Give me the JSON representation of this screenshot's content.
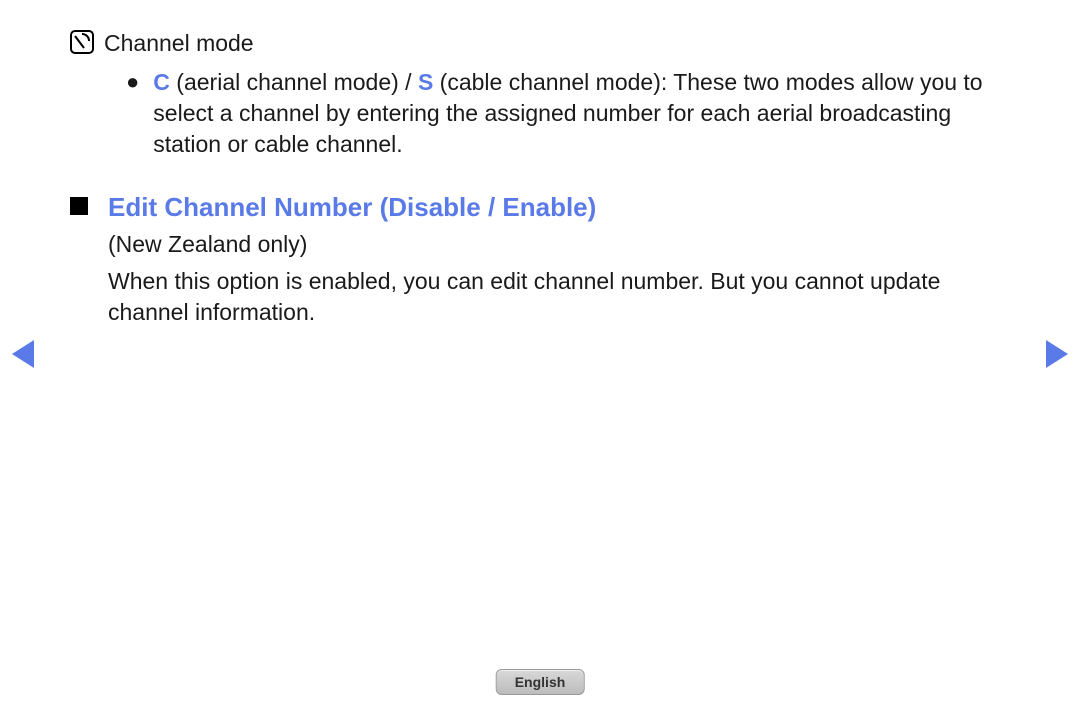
{
  "section1": {
    "title": "Channel mode",
    "bullet": {
      "c_label": "C",
      "c_text": " (aerial channel mode) / ",
      "s_label": "S",
      "s_text": " (cable channel mode): These two modes allow you to select a channel by entering the assigned number for each aerial broadcasting station or cable channel."
    }
  },
  "section2": {
    "title": "Edit Channel Number (Disable / Enable)",
    "subtitle": "(New Zealand only)",
    "body": "When this option is enabled, you can edit channel number. But you cannot update channel information."
  },
  "footer": {
    "language": "English"
  }
}
